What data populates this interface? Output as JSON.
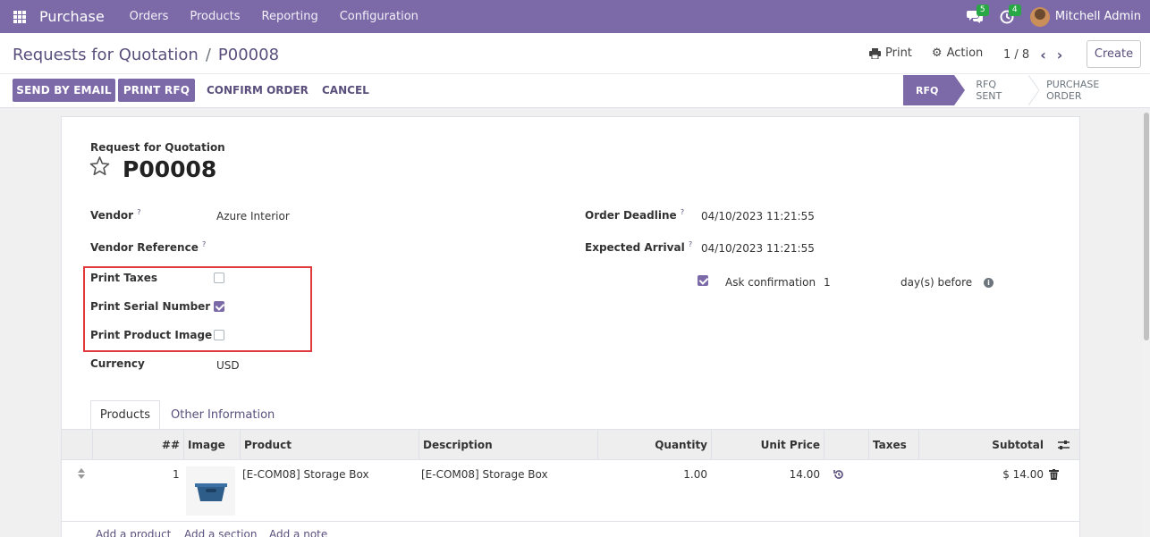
{
  "nav": {
    "app_name": "Purchase",
    "menus": [
      "Orders",
      "Products",
      "Reporting",
      "Configuration"
    ],
    "messages_count": "5",
    "activities_count": "4",
    "user": "Mitchell Admin"
  },
  "control": {
    "breadcrumb_parent": "Requests for Quotation",
    "breadcrumb_sep": "/",
    "breadcrumb_current": "P00008",
    "print_label": "Print",
    "action_label": "Action",
    "pager": "1 / 8",
    "create_label": "Create"
  },
  "buttons": {
    "send_email": "SEND BY EMAIL",
    "print_rfq": "PRINT RFQ",
    "confirm": "CONFIRM ORDER",
    "cancel": "CANCEL"
  },
  "status": {
    "stages": [
      "RFQ",
      "RFQ SENT",
      "PURCHASE ORDER"
    ],
    "active": "RFQ"
  },
  "form": {
    "subtitle": "Request for Quotation",
    "name": "P00008",
    "vendor_label": "Vendor",
    "vendor": "Azure Interior",
    "vendor_ref_label": "Vendor Reference",
    "print_taxes_label": "Print Taxes",
    "print_taxes": false,
    "print_serial_label": "Print Serial Number",
    "print_serial": true,
    "print_image_label": "Print Product Image",
    "print_image": false,
    "currency_label": "Currency",
    "currency": "USD",
    "deadline_label": "Order Deadline",
    "deadline": "04/10/2023 11:21:55",
    "arrival_label": "Expected Arrival",
    "arrival": "04/10/2023 11:21:55",
    "ask_confirm_label": "Ask confirmation",
    "ask_confirm_days": "1",
    "ask_confirm_suffix": "day(s) before",
    "help_mark": "?",
    "info_mark": "i"
  },
  "tabs": [
    "Products",
    "Other Information"
  ],
  "table": {
    "headers": {
      "seq": "##",
      "image": "Image",
      "product": "Product",
      "description": "Description",
      "quantity": "Quantity",
      "unit_price": "Unit Price",
      "taxes": "Taxes",
      "subtotal": "Subtotal"
    },
    "rows": [
      {
        "seq": "1",
        "product": "[E-COM08] Storage Box",
        "description": "[E-COM08] Storage Box",
        "quantity": "1.00",
        "unit_price": "14.00",
        "taxes": "",
        "subtotal": "$ 14.00"
      }
    ],
    "add_product": "Add a product",
    "add_section": "Add a section",
    "add_note": "Add a note"
  },
  "colors": {
    "primary": "#7c6aa8",
    "highlight": "#e0393e",
    "badge": "#28a745"
  }
}
